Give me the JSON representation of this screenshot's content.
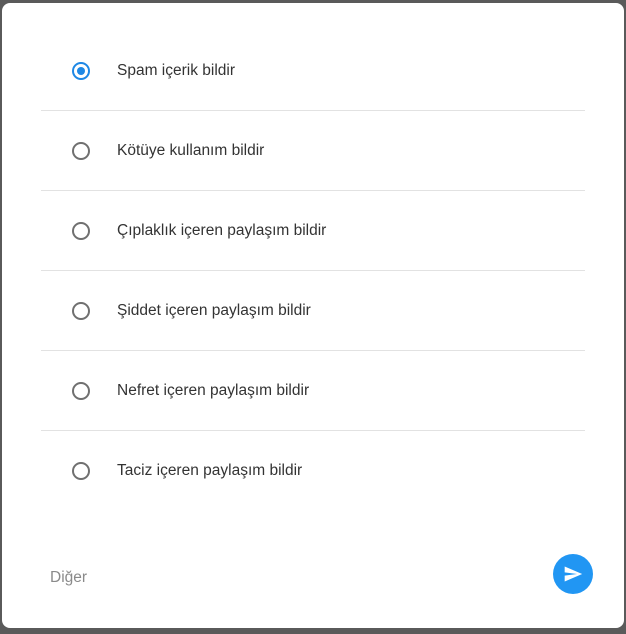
{
  "report_dialog": {
    "options": [
      {
        "label": "Spam içerik bildir",
        "selected": true
      },
      {
        "label": "Kötüye kullanım bildir",
        "selected": false
      },
      {
        "label": "Çıplaklık içeren paylaşım bildir",
        "selected": false
      },
      {
        "label": "Şiddet içeren paylaşım bildir",
        "selected": false
      },
      {
        "label": "Nefret içeren paylaşım bildir",
        "selected": false
      },
      {
        "label": "Taciz içeren paylaşım bildir",
        "selected": false
      }
    ],
    "other": {
      "placeholder": "Diğer",
      "value": ""
    },
    "send_icon": "send-icon"
  },
  "colors": {
    "accent": "#2196f3",
    "radio_checked": "#1e88e5",
    "radio_unchecked": "#707070",
    "divider": "#e2e2e2"
  }
}
